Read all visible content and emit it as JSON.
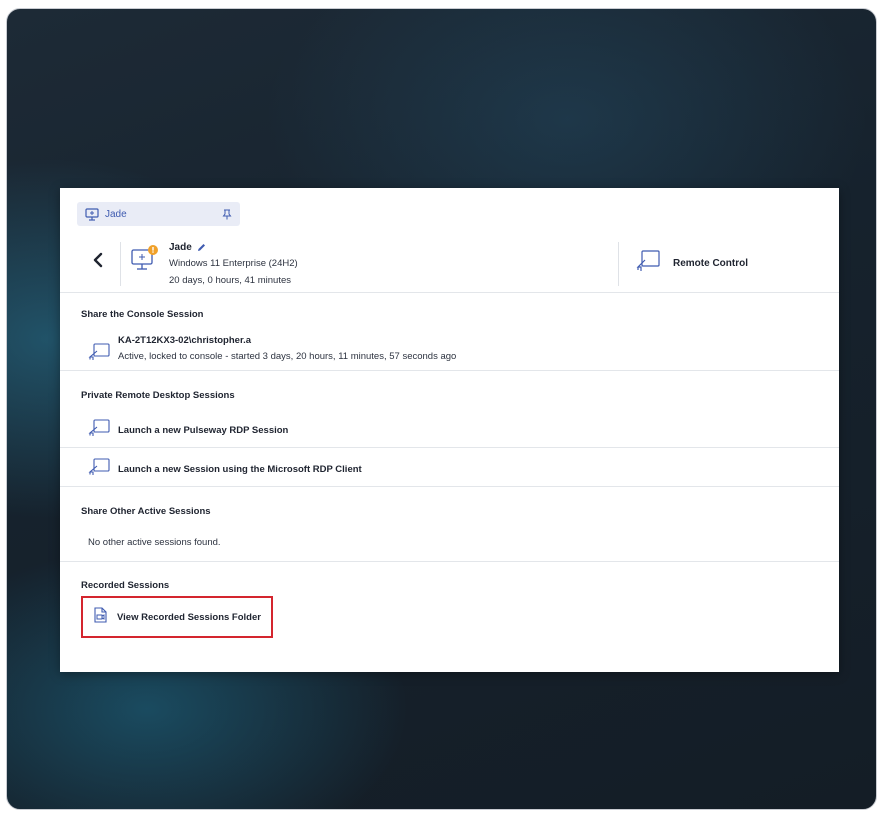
{
  "device_tab": {
    "label": "Jade",
    "icon": "monitor-icon",
    "pin_icon": "pin-icon"
  },
  "header": {
    "back_icon": "chevron-left-icon",
    "device_name": "Jade",
    "os": "Windows 11 Enterprise (24H2)",
    "uptime": "20 days, 0 hours, 41 minutes",
    "remote_control_label": "Remote Control"
  },
  "sections": {
    "console": {
      "title": "Share the Console Session",
      "user": "KA-2T12KX3-02\\christopher.a",
      "status": "Active, locked to console - started 3 days, 20 hours, 11 minutes, 57 seconds ago"
    },
    "private": {
      "title": "Private Remote Desktop Sessions",
      "items": [
        {
          "label": "Launch a new Pulseway RDP Session"
        },
        {
          "label": "Launch a new Session using the Microsoft RDP Client"
        }
      ]
    },
    "other": {
      "title": "Share Other Active Sessions",
      "empty": "No other active sessions found."
    },
    "recorded": {
      "title": "Recorded Sessions",
      "button_label": "View Recorded Sessions Folder"
    }
  },
  "colors": {
    "accent": "#3f5bb0",
    "warning_badge": "#f0a12b",
    "highlight_box": "#d4252e"
  }
}
